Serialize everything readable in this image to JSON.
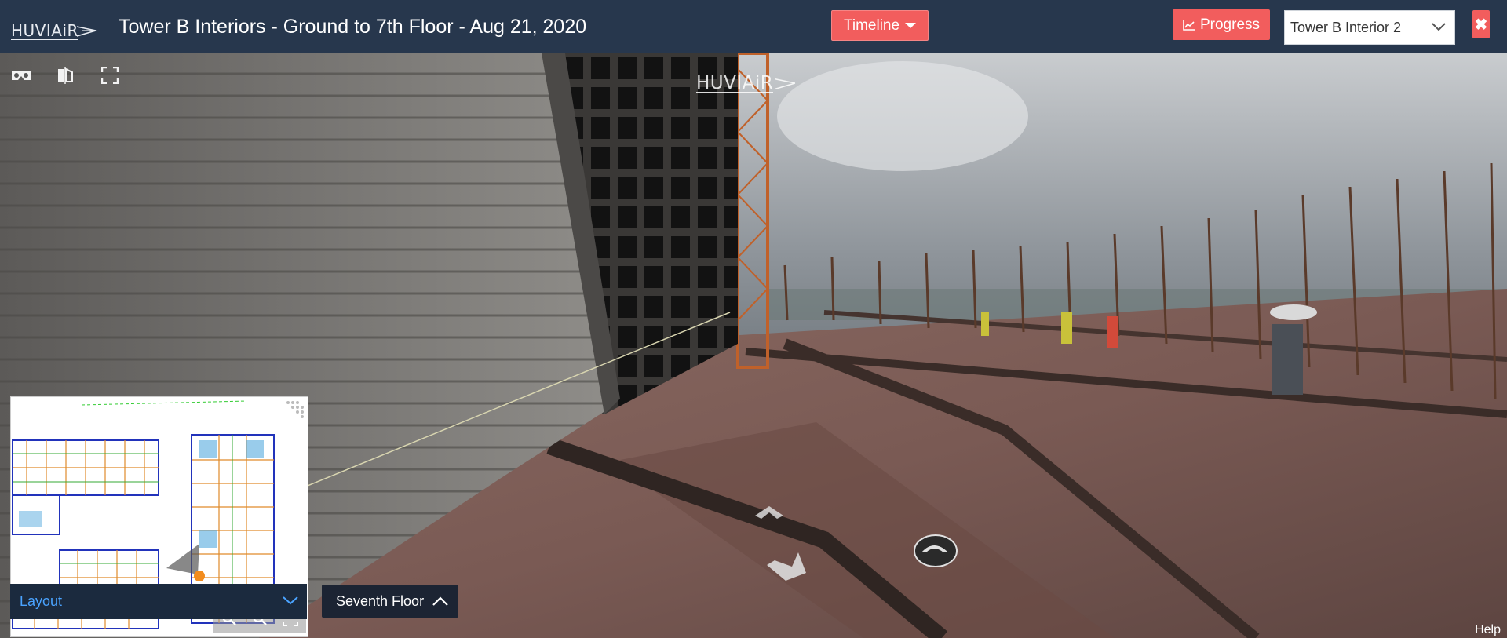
{
  "header": {
    "logo_text": "HUVIAiR",
    "title": "Tower B Interiors - Ground to 7th Floor - Aug 21, 2020",
    "timeline_label": "Timeline",
    "progress_label": "Progress",
    "view_select_value": "Tower B Interior 2",
    "close_symbol": "✖"
  },
  "viewer": {
    "watermark_text": "HUVIAiR",
    "tools": [
      "vr-headset-icon",
      "split-compare-icon",
      "fullscreen-icon"
    ],
    "help_label": "Help"
  },
  "minimap": {
    "layout_label": "Layout",
    "floor_label": "Seventh Floor",
    "tools": [
      "zoom-in-icon",
      "zoom-out-icon",
      "expand-icon"
    ]
  },
  "colors": {
    "topbar": "#27374d",
    "accent_red": "#f25d5d",
    "layout_bar": "#1b2a3e",
    "layout_text": "#4aa3ff",
    "position_marker": "#f28c1e"
  }
}
